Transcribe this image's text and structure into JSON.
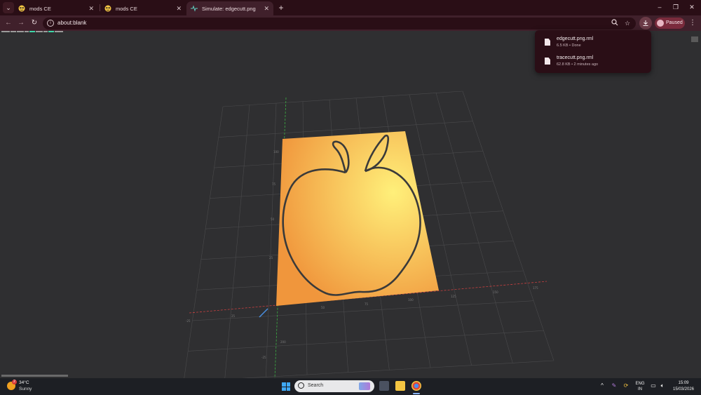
{
  "browser": {
    "tabs": [
      {
        "title": "mods CE",
        "active": false
      },
      {
        "title": "mods CE",
        "active": false
      },
      {
        "title": "Simulate: edgecutt.png",
        "active": true
      }
    ],
    "tab_close_glyph": "✕",
    "new_tab_glyph": "+",
    "address": "about:blank",
    "profile_label": "Paused",
    "window_controls": {
      "minimize": "–",
      "maximize": "❐",
      "close": "✕"
    }
  },
  "downloads": [
    {
      "name": "edgecutt.png.rml",
      "meta": "6.5 KB • Done"
    },
    {
      "name": "tracecutt.png.rml",
      "meta": "62.8 KB • 2 minutes ago"
    }
  ],
  "scene": {
    "plate_color_light": "#fff07a",
    "plate_color_dark": "#f0963c",
    "outline_color": "#3a3a3a",
    "grid_color": "#4a4a4c",
    "axis_x_color": "#c84040",
    "axis_y_color": "#3cb043",
    "axis_z_color": "#4a90e2",
    "axis_tick_labels": [
      {
        "text": "-25"
      },
      {
        "text": "25"
      },
      {
        "text": "50"
      },
      {
        "text": "75"
      },
      {
        "text": "100"
      },
      {
        "text": "125"
      },
      {
        "text": "150"
      },
      {
        "text": "175"
      },
      {
        "text": "200"
      },
      {
        "text": "25"
      },
      {
        "text": "50"
      },
      {
        "text": "75"
      },
      {
        "text": "100"
      },
      {
        "text": "-25"
      }
    ]
  },
  "taskbar": {
    "weather_temp": "34°C",
    "weather_condition": "Sunny",
    "weather_badge": "2",
    "search_placeholder": "Search",
    "lang_top": "ENG",
    "lang_bottom": "IN",
    "time": "15:09",
    "date": "15/03/2026",
    "tray_overflow": "^"
  }
}
